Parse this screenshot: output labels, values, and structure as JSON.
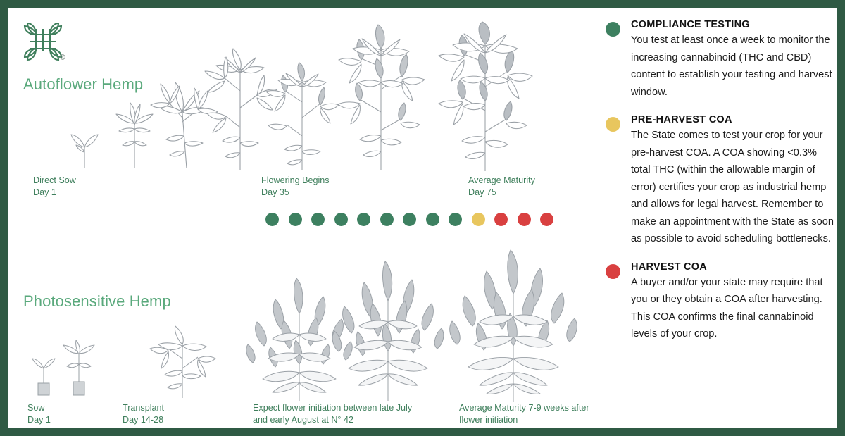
{
  "brand": {
    "logo_icon": "hemp-knot-logo-icon",
    "registered_mark": "®",
    "frame_color": "#2f5a44",
    "green_text": "#3f7f5c",
    "title_green": "#5aa97c"
  },
  "status_colors": {
    "green": "#3d8060",
    "yellow": "#e8c65e",
    "red": "#d94040"
  },
  "sections": [
    {
      "id": "autoflower",
      "title": "Autoflower Hemp",
      "stages": [
        {
          "name": "Direct Sow",
          "day": "Day 1"
        },
        {
          "name": "Flowering Begins",
          "day": "Day 35"
        },
        {
          "name": "Average Maturity",
          "day": "Day 75"
        }
      ]
    },
    {
      "id": "photosensitive",
      "title": "Photosensitive Hemp",
      "stages": [
        {
          "name": "Sow",
          "day": "Day 1"
        },
        {
          "name": "Transplant",
          "day": "Day 14-28"
        },
        {
          "name": "Expect flower initiation between late July and early August at N° 42",
          "day": ""
        },
        {
          "name": "Average Maturity 7-9 weeks after flower initiation",
          "day": ""
        }
      ]
    }
  ],
  "timeline": {
    "label": "weekly-compliance-test-timeline",
    "total_dots": 13,
    "dots": [
      "green",
      "green",
      "green",
      "green",
      "green",
      "green",
      "green",
      "green",
      "green",
      "yellow",
      "red",
      "red",
      "red"
    ]
  },
  "legend": [
    {
      "dot": "green",
      "heading": "COMPLIANCE TESTING",
      "body": "You test at least once a week to monitor the increasing cannabinoid (THC and CBD) content to establish your testing and harvest window."
    },
    {
      "dot": "yellow",
      "heading": "PRE-HARVEST COA",
      "body": "The State comes to test your crop for your pre-harvest COA. A COA showing <0.3% total THC (within the allowable margin of error) certifies your crop as industrial hemp and allows for legal harvest. Remember to make an appointment with the State as soon as possible to avoid scheduling bottlenecks."
    },
    {
      "dot": "red",
      "heading": "HARVEST COA",
      "body": "A buyer and/or your state may require that you or they obtain a COA after harvesting. This COA confirms the final cannabinoid levels of your crop."
    }
  ],
  "illustration": {
    "style": "gray-line-art-hemp-plants",
    "fill": "#c3c7cb",
    "stroke": "#9aa0a6",
    "leaf_light": "#f2f3f4"
  }
}
